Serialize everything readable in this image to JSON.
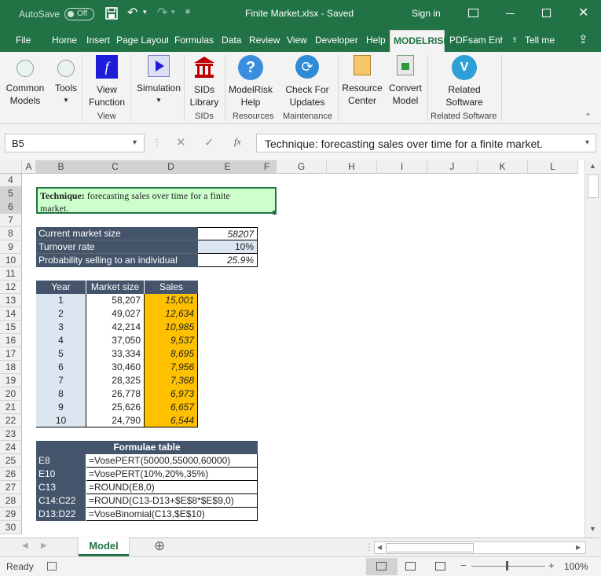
{
  "titlebar": {
    "autosave_label": "AutoSave",
    "autosave_state": "Off",
    "file_title": "Finite Market.xlsx  -  Saved",
    "signin": "Sign in"
  },
  "tabs": [
    "File",
    "Home",
    "Insert",
    "Page Layout",
    "Formulas",
    "Data",
    "Review",
    "View",
    "Developer",
    "Help",
    "MODELRISK",
    "PDFsam Enh",
    "Tell me"
  ],
  "ribbon": {
    "buttons": [
      "Common\nModels",
      "Tools",
      "View\nFunction",
      "Simulation",
      "SIDs\nLibrary",
      "ModelRisk\nHelp",
      "Check For\nUpdates",
      "Resource\nCenter",
      "Convert\nModel",
      "Related\nSoftware"
    ],
    "groups": [
      "View",
      "SIDs",
      "Resources",
      "Maintenance",
      "Related Software"
    ]
  },
  "formula_bar": {
    "name_box": "B5",
    "content": "Technique: forecasting sales over time for a finite market.",
    "fx": "fx"
  },
  "columns": [
    "A",
    "B",
    "C",
    "D",
    "E",
    "F",
    "G",
    "H",
    "I",
    "J",
    "K",
    "L"
  ],
  "rows": [
    "4",
    "5",
    "6",
    "7",
    "8",
    "9",
    "10",
    "11",
    "12",
    "13",
    "14",
    "15",
    "16",
    "17",
    "18",
    "19",
    "20",
    "21",
    "22",
    "23",
    "24",
    "25",
    "26",
    "27",
    "28",
    "29",
    "30"
  ],
  "technique": {
    "bold": "Technique:",
    "text": " forecasting sales over time for a finite",
    "text2": "market."
  },
  "params": [
    {
      "label": "Current market size",
      "value": "58207"
    },
    {
      "label": "Turnover rate",
      "value": "10%"
    },
    {
      "label": "Probability selling to an individual",
      "value": "25.9%"
    }
  ],
  "table": {
    "headers": [
      "Year",
      "Market size",
      "Sales"
    ],
    "rows": [
      [
        "1",
        "58,207",
        "15,001"
      ],
      [
        "2",
        "49,027",
        "12,634"
      ],
      [
        "3",
        "42,214",
        "10,985"
      ],
      [
        "4",
        "37,050",
        "9,537"
      ],
      [
        "5",
        "33,334",
        "8,695"
      ],
      [
        "6",
        "30,460",
        "7,956"
      ],
      [
        "7",
        "28,325",
        "7,368"
      ],
      [
        "8",
        "26,778",
        "6,973"
      ],
      [
        "9",
        "25,626",
        "6,657"
      ],
      [
        "10",
        "24,790",
        "6,544"
      ]
    ]
  },
  "formulae": {
    "title": "Formulae table",
    "rows": [
      [
        "E8",
        "=VosePERT(50000,55000,60000)"
      ],
      [
        "E10",
        "=VosePERT(10%,20%,35%)"
      ],
      [
        "C13",
        "=ROUND(E8,0)"
      ],
      [
        "C14:C22",
        "=ROUND(C13-D13+$E$8*$E$9,0)"
      ],
      [
        "D13:D22",
        "=VoseBinomial(C13,$E$10)"
      ]
    ]
  },
  "sheet_tab": "Model",
  "status": {
    "ready": "Ready",
    "zoom": "100%"
  }
}
